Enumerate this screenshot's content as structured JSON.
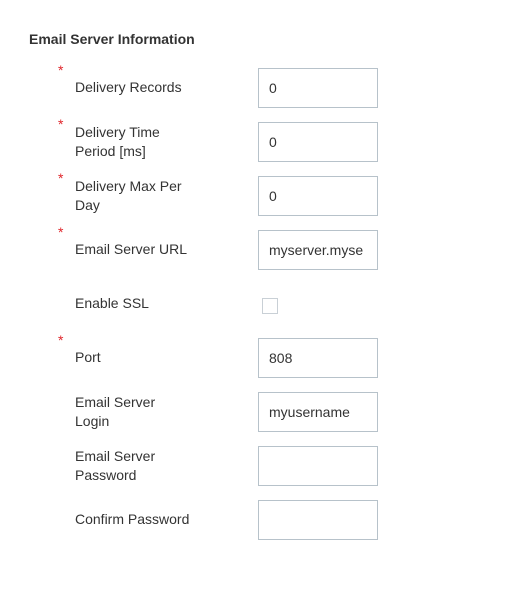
{
  "section": {
    "title": "Email Server Information"
  },
  "fields": [
    {
      "label": "Delivery Records",
      "value": "0",
      "required": true,
      "type": "text"
    },
    {
      "label": "Delivery Time Period [ms]",
      "value": "0",
      "required": true,
      "type": "text"
    },
    {
      "label": "Delivery Max Per Day",
      "value": "0",
      "required": true,
      "type": "text"
    },
    {
      "label": "Email Server URL",
      "value": "myserver.myse",
      "required": true,
      "type": "text"
    },
    {
      "label": "Enable SSL",
      "checked": false,
      "required": false,
      "type": "checkbox"
    },
    {
      "label": "Port",
      "value": "808",
      "required": true,
      "type": "text"
    },
    {
      "label": "Email Server Login",
      "value": "myusername",
      "required": false,
      "type": "text"
    },
    {
      "label": "Email Server Password",
      "value": "",
      "required": false,
      "type": "password"
    },
    {
      "label": "Confirm Password",
      "value": "",
      "required": false,
      "type": "password"
    }
  ],
  "required_marker": "*",
  "colors": {
    "required": "#e0262b",
    "border": "#b7c2ca",
    "text": "#333333"
  }
}
